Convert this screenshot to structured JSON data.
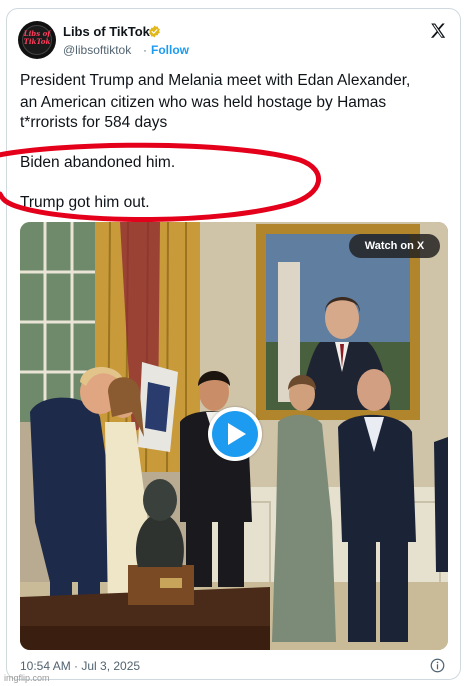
{
  "post": {
    "author_name": "Libs of TikTok",
    "author_handle": "@libsoftiktok",
    "separator": "·",
    "follow_label": "Follow",
    "avatar_text_line1": "Libs of",
    "avatar_text_line2": "TikTok",
    "body_lines": [
      "President Trump and Melania meet with  Edan Alexander,",
      "an American citizen who was held hostage by Hamas",
      "t*rrorists for 584 days",
      "Biden abandoned him.",
      "Trump got him out."
    ],
    "timestamp": "10:54 AM · Jul 3, 2025"
  },
  "media": {
    "watch_label": "Watch on X"
  },
  "watermark": "imgflip.com",
  "colors": {
    "accent": "#1d9bf0",
    "text": "#0f1419",
    "muted": "#536471",
    "annotation_red": "#e4001b",
    "verified_gold": "#e2b719"
  }
}
